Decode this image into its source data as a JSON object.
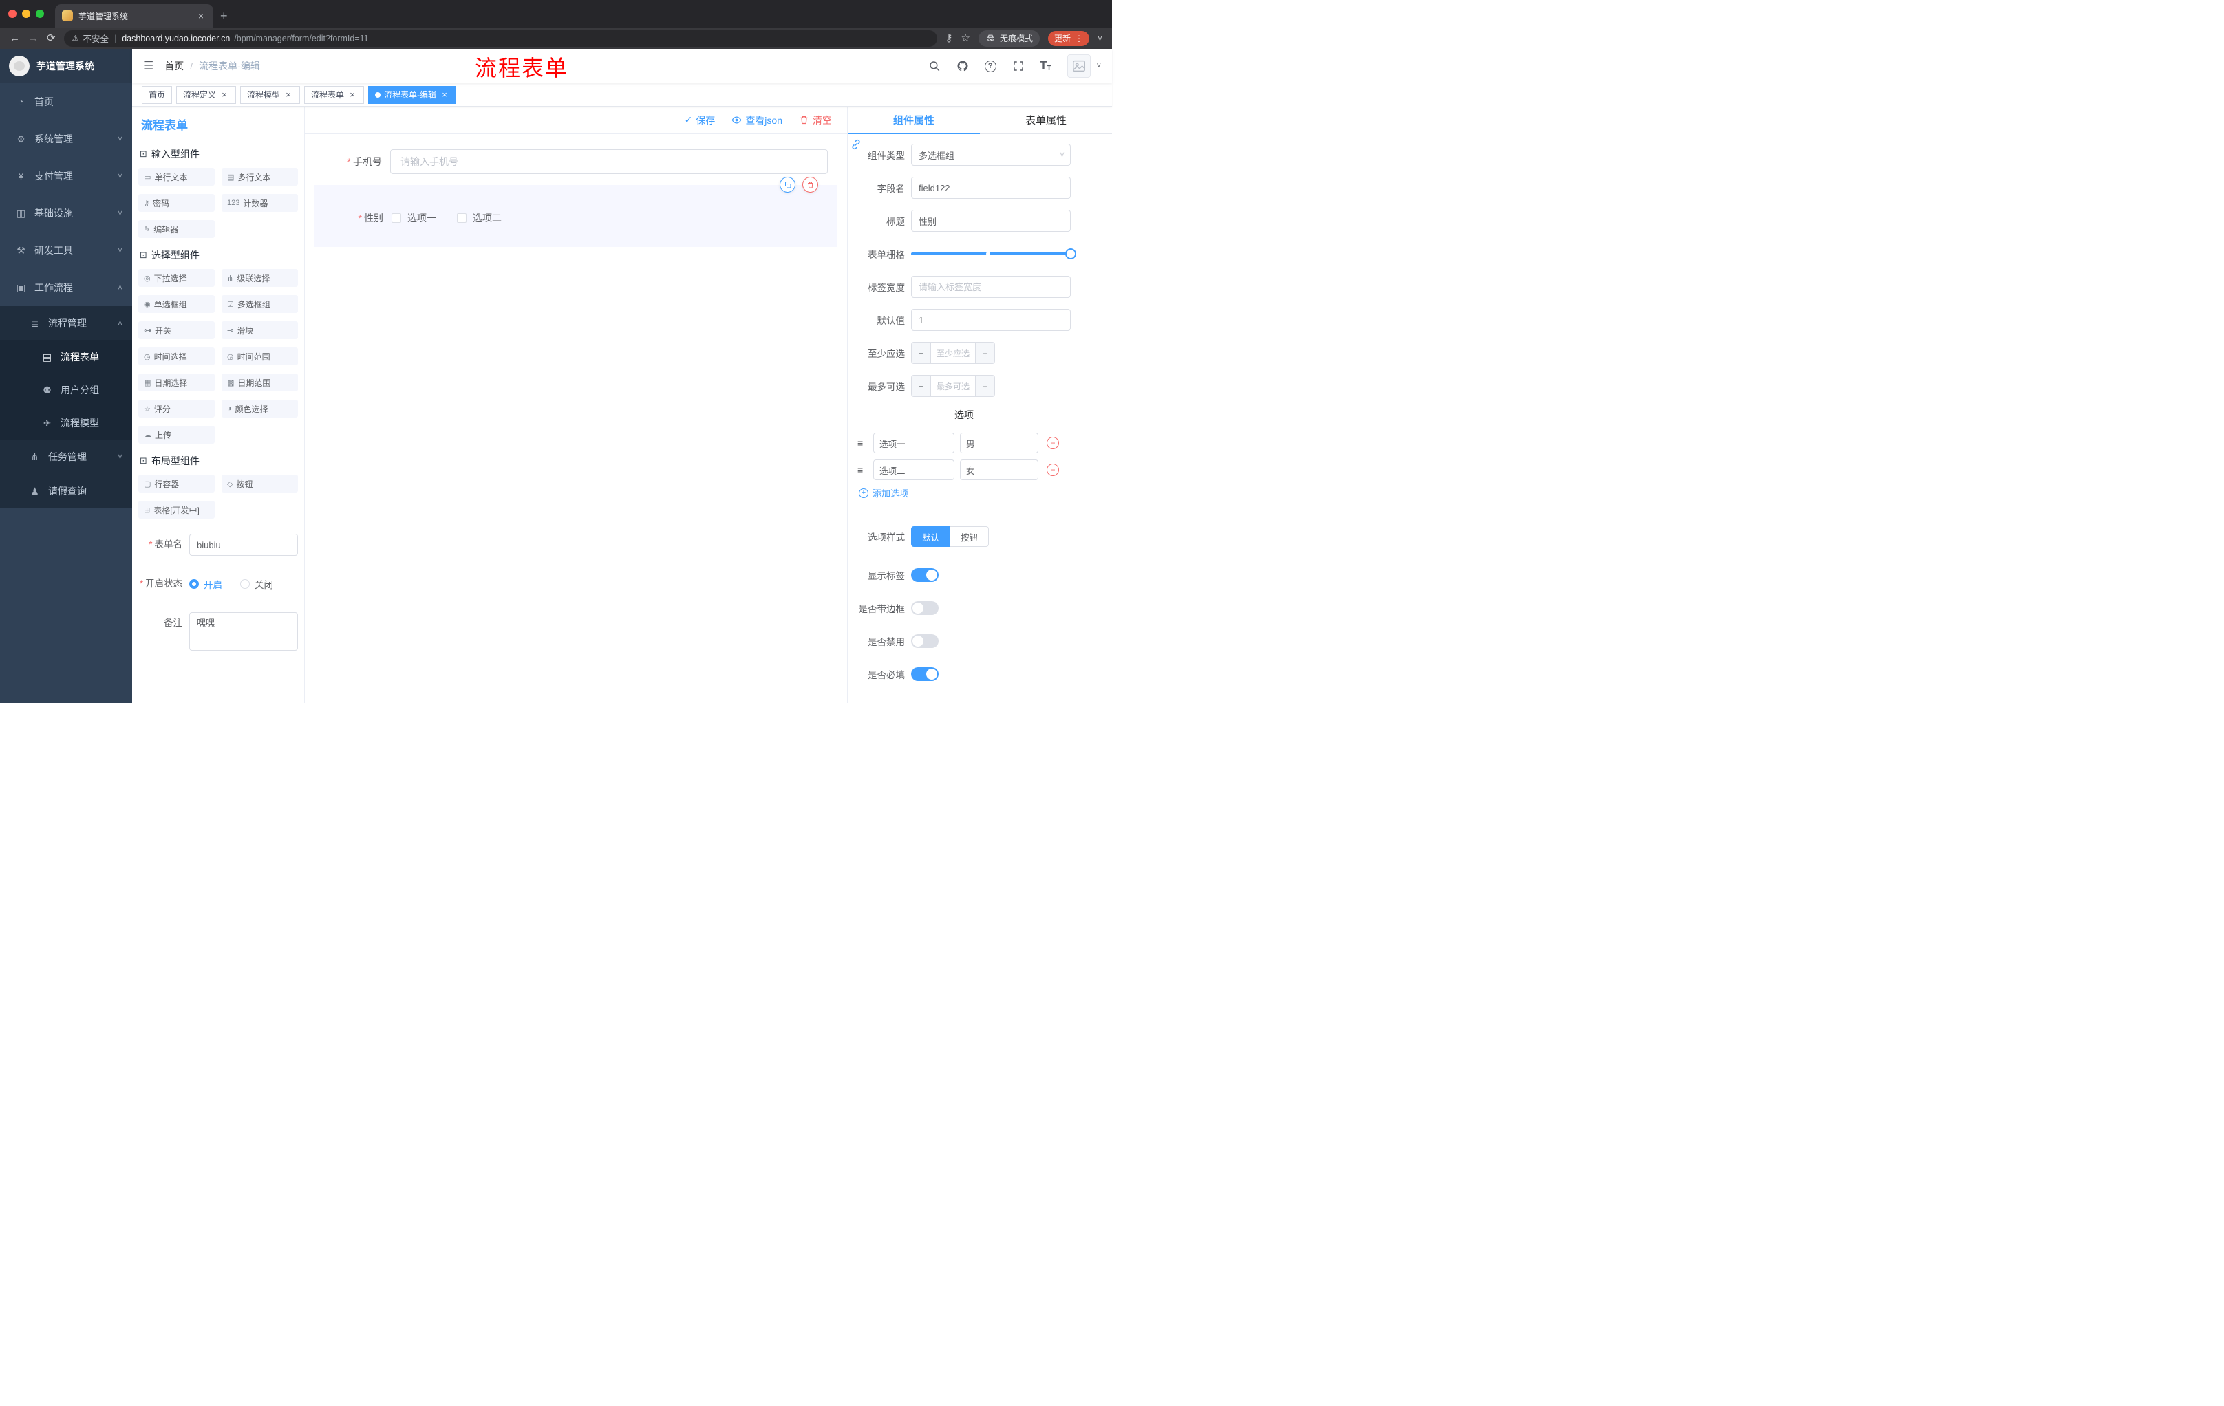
{
  "icons": {
    "close": "×",
    "new_tab": "+",
    "back": "←",
    "forward": "→",
    "reload": "⟳",
    "warning": "⚠",
    "divider": "|",
    "key": "⚷",
    "star": "☆",
    "more_vert": "⋮",
    "chevron_small": "˅",
    "hamburger": "☰",
    "slash": "/",
    "chevron_up": "˄",
    "chevron_down": "˅",
    "check": "✓",
    "question": "?",
    "asterisk": "*",
    "minus": "−",
    "plus": "+",
    "drag": "≡",
    "font_large": "T",
    "font_small": "T"
  },
  "browser": {
    "tab_title": "芋道管理系统",
    "security": "不安全",
    "url_domain": "dashboard.yudao.iocoder.cn",
    "url_path": "/bpm/manager/form/edit?formId=11",
    "incognito": "无痕模式",
    "update": "更新"
  },
  "annotation": "流程表单",
  "sidebar": {
    "logo": "芋道管理系统",
    "items": [
      {
        "icon": "◔",
        "label": "首页"
      },
      {
        "icon": "⚙",
        "label": "系统管理"
      },
      {
        "icon": "¥",
        "label": "支付管理"
      },
      {
        "icon": "▥",
        "label": "基础设施"
      },
      {
        "icon": "⚒",
        "label": "研发工具"
      },
      {
        "icon": "▣",
        "label": "工作流程"
      },
      {
        "icon": "≣",
        "label": "流程管理"
      },
      {
        "icon": "▤",
        "label": "流程表单"
      },
      {
        "icon": "⚉",
        "label": "用户分组"
      },
      {
        "icon": "✈",
        "label": "流程模型"
      },
      {
        "icon": "⋔",
        "label": "任务管理"
      },
      {
        "icon": "♟",
        "label": "请假查询"
      }
    ]
  },
  "header": {
    "breadcrumb": [
      "首页",
      "流程表单-编辑"
    ]
  },
  "tags": [
    {
      "label": "首页"
    },
    {
      "label": "流程定义"
    },
    {
      "label": "流程模型"
    },
    {
      "label": "流程表单"
    },
    {
      "label": "流程表单-编辑"
    }
  ],
  "palette": {
    "title": "流程表单",
    "groups": [
      {
        "title": "输入型组件",
        "items": [
          {
            "icon": "▭",
            "label": "单行文本"
          },
          {
            "icon": "▤",
            "label": "多行文本"
          },
          {
            "icon": "⚷",
            "label": "密码"
          },
          {
            "icon": "123",
            "label": "计数器"
          },
          {
            "icon": "✎",
            "label": "编辑器"
          }
        ]
      },
      {
        "title": "选择型组件",
        "items": [
          {
            "icon": "◎",
            "label": "下拉选择"
          },
          {
            "icon": "⋔",
            "label": "级联选择"
          },
          {
            "icon": "◉",
            "label": "单选框组"
          },
          {
            "icon": "☑",
            "label": "多选框组"
          },
          {
            "icon": "⊶",
            "label": "开关"
          },
          {
            "icon": "⊸",
            "label": "滑块"
          },
          {
            "icon": "◷",
            "label": "时间选择"
          },
          {
            "icon": "◶",
            "label": "时间范围"
          },
          {
            "icon": "▦",
            "label": "日期选择"
          },
          {
            "icon": "▩",
            "label": "日期范围"
          },
          {
            "icon": "☆",
            "label": "评分"
          },
          {
            "icon": "◑",
            "label": "颜色选择"
          },
          {
            "icon": "☁",
            "label": "上传"
          }
        ]
      },
      {
        "title": "布局型组件",
        "items": [
          {
            "icon": "▢",
            "label": "行容器"
          },
          {
            "icon": "◇",
            "label": "按钮"
          },
          {
            "icon": "⊞",
            "label": "表格[开发中]"
          }
        ]
      }
    ],
    "form": {
      "name_label": "表单名",
      "name_value": "biubiu",
      "status_label": "开启状态",
      "status_on": "开启",
      "status_off": "关闭",
      "remark_label": "备注",
      "remark_value": "嘿嘿"
    }
  },
  "canvas": {
    "toolbar": {
      "save": "保存",
      "view_json": "查看json",
      "clear": "清空"
    },
    "phone": {
      "label": "手机号",
      "placeholder": "请输入手机号"
    },
    "gender": {
      "label": "性别",
      "option1": "选项一",
      "option2": "选项二"
    }
  },
  "props": {
    "tab_component": "组件属性",
    "tab_form": "表单属性",
    "component_type": {
      "label": "组件类型",
      "value": "多选框组"
    },
    "field_name": {
      "label": "字段名",
      "value": "field122"
    },
    "title": {
      "label": "标题",
      "value": "性别"
    },
    "grid": {
      "label": "表单栅格"
    },
    "label_width": {
      "label": "标签宽度",
      "placeholder": "请输入标签宽度"
    },
    "default": {
      "label": "默认值",
      "value": "1"
    },
    "min": {
      "label": "至少应选",
      "placeholder": "至少应选"
    },
    "max": {
      "label": "最多可选",
      "placeholder": "最多可选"
    },
    "options": {
      "title": "选项",
      "rows": [
        {
          "label": "选项一",
          "value": "男"
        },
        {
          "label": "选项二",
          "value": "女"
        }
      ],
      "add": "添加选项"
    },
    "style": {
      "label": "选项样式",
      "default": "默认",
      "button": "按钮"
    },
    "switches": [
      {
        "label": "显示标签",
        "on": true
      },
      {
        "label": "是否带边框",
        "on": false
      },
      {
        "label": "是否禁用",
        "on": false
      },
      {
        "label": "是否必填",
        "on": true
      }
    ]
  }
}
